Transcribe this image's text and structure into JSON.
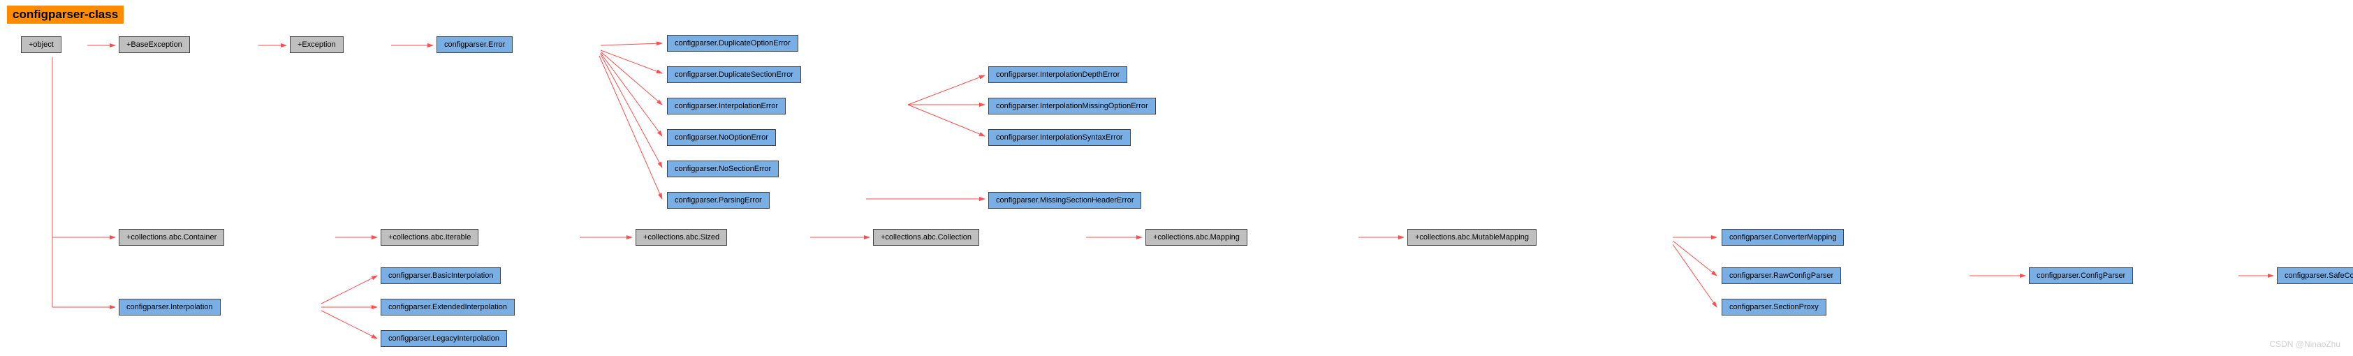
{
  "title": "configparser-class",
  "watermark": "CSDN @NinaoZhu",
  "nodes": {
    "object": "+object",
    "baseexc": "+BaseException",
    "exc": "+Exception",
    "cp_error": "configparser.Error",
    "cp_dup_opt": "configparser.DuplicateOptionError",
    "cp_dup_sec": "configparser.DuplicateSectionError",
    "cp_int_err": "configparser.InterpolationError",
    "cp_int_depth": "configparser.InterpolationDepthError",
    "cp_int_miss": "configparser.InterpolationMissingOptionError",
    "cp_int_syn": "configparser.InterpolationSyntaxError",
    "cp_noopt": "configparser.NoOptionError",
    "cp_nosec": "configparser.NoSectionError",
    "cp_parse": "configparser.ParsingError",
    "cp_misshdr": "configparser.MissingSectionHeaderError",
    "abc_container": "+collections.abc.Container",
    "abc_iterable": "+collections.abc.Iterable",
    "abc_sized": "+collections.abc.Sized",
    "abc_collection": "+collections.abc.Collection",
    "abc_mapping": "+collections.abc.Mapping",
    "abc_mutmapping": "+collections.abc.MutableMapping",
    "cp_convmap": "configparser.ConverterMapping",
    "cp_rawcfg": "configparser.RawConfigParser",
    "cp_secproxy": "configparser.SectionProxy",
    "cp_cfgparser": "configparser.ConfigParser",
    "cp_safecfg": "configparser.SafeConfigParser",
    "cp_interp": "configparser.Interpolation",
    "cp_basicint": "configparser.BasicInterpolation",
    "cp_extint": "configparser.ExtendedInterpolation",
    "cp_legint": "configparser.LegacyInterpolation"
  },
  "chart_data": {
    "type": "diagram",
    "title": "configparser-class",
    "nodes": [
      {
        "id": "object",
        "label": "+object",
        "kind": "builtin"
      },
      {
        "id": "baseexc",
        "label": "+BaseException",
        "kind": "builtin"
      },
      {
        "id": "exc",
        "label": "+Exception",
        "kind": "builtin"
      },
      {
        "id": "cp_error",
        "label": "configparser.Error",
        "kind": "module"
      },
      {
        "id": "cp_dup_opt",
        "label": "configparser.DuplicateOptionError",
        "kind": "module"
      },
      {
        "id": "cp_dup_sec",
        "label": "configparser.DuplicateSectionError",
        "kind": "module"
      },
      {
        "id": "cp_int_err",
        "label": "configparser.InterpolationError",
        "kind": "module"
      },
      {
        "id": "cp_int_depth",
        "label": "configparser.InterpolationDepthError",
        "kind": "module"
      },
      {
        "id": "cp_int_miss",
        "label": "configparser.InterpolationMissingOptionError",
        "kind": "module"
      },
      {
        "id": "cp_int_syn",
        "label": "configparser.InterpolationSyntaxError",
        "kind": "module"
      },
      {
        "id": "cp_noopt",
        "label": "configparser.NoOptionError",
        "kind": "module"
      },
      {
        "id": "cp_nosec",
        "label": "configparser.NoSectionError",
        "kind": "module"
      },
      {
        "id": "cp_parse",
        "label": "configparser.ParsingError",
        "kind": "module"
      },
      {
        "id": "cp_misshdr",
        "label": "configparser.MissingSectionHeaderError",
        "kind": "module"
      },
      {
        "id": "abc_container",
        "label": "+collections.abc.Container",
        "kind": "builtin"
      },
      {
        "id": "abc_iterable",
        "label": "+collections.abc.Iterable",
        "kind": "builtin"
      },
      {
        "id": "abc_sized",
        "label": "+collections.abc.Sized",
        "kind": "builtin"
      },
      {
        "id": "abc_collection",
        "label": "+collections.abc.Collection",
        "kind": "builtin"
      },
      {
        "id": "abc_mapping",
        "label": "+collections.abc.Mapping",
        "kind": "builtin"
      },
      {
        "id": "abc_mutmapping",
        "label": "+collections.abc.MutableMapping",
        "kind": "builtin"
      },
      {
        "id": "cp_convmap",
        "label": "configparser.ConverterMapping",
        "kind": "module"
      },
      {
        "id": "cp_rawcfg",
        "label": "configparser.RawConfigParser",
        "kind": "module"
      },
      {
        "id": "cp_secproxy",
        "label": "configparser.SectionProxy",
        "kind": "module"
      },
      {
        "id": "cp_cfgparser",
        "label": "configparser.ConfigParser",
        "kind": "module"
      },
      {
        "id": "cp_safecfg",
        "label": "configparser.SafeConfigParser",
        "kind": "module"
      },
      {
        "id": "cp_interp",
        "label": "configparser.Interpolation",
        "kind": "module"
      },
      {
        "id": "cp_basicint",
        "label": "configparser.BasicInterpolation",
        "kind": "module"
      },
      {
        "id": "cp_extint",
        "label": "configparser.ExtendedInterpolation",
        "kind": "module"
      },
      {
        "id": "cp_legint",
        "label": "configparser.LegacyInterpolation",
        "kind": "module"
      }
    ],
    "edges": [
      {
        "from": "object",
        "to": "baseexc"
      },
      {
        "from": "baseexc",
        "to": "exc"
      },
      {
        "from": "exc",
        "to": "cp_error"
      },
      {
        "from": "cp_error",
        "to": "cp_dup_opt"
      },
      {
        "from": "cp_error",
        "to": "cp_dup_sec"
      },
      {
        "from": "cp_error",
        "to": "cp_int_err"
      },
      {
        "from": "cp_error",
        "to": "cp_noopt"
      },
      {
        "from": "cp_error",
        "to": "cp_nosec"
      },
      {
        "from": "cp_error",
        "to": "cp_parse"
      },
      {
        "from": "cp_int_err",
        "to": "cp_int_depth"
      },
      {
        "from": "cp_int_err",
        "to": "cp_int_miss"
      },
      {
        "from": "cp_int_err",
        "to": "cp_int_syn"
      },
      {
        "from": "cp_parse",
        "to": "cp_misshdr"
      },
      {
        "from": "object",
        "to": "abc_container"
      },
      {
        "from": "abc_container",
        "to": "abc_iterable"
      },
      {
        "from": "abc_iterable",
        "to": "abc_sized"
      },
      {
        "from": "abc_sized",
        "to": "abc_collection"
      },
      {
        "from": "abc_collection",
        "to": "abc_mapping"
      },
      {
        "from": "abc_mapping",
        "to": "abc_mutmapping"
      },
      {
        "from": "abc_mutmapping",
        "to": "cp_convmap"
      },
      {
        "from": "abc_mutmapping",
        "to": "cp_rawcfg"
      },
      {
        "from": "abc_mutmapping",
        "to": "cp_secproxy"
      },
      {
        "from": "cp_rawcfg",
        "to": "cp_cfgparser"
      },
      {
        "from": "cp_cfgparser",
        "to": "cp_safecfg"
      },
      {
        "from": "object",
        "to": "cp_interp"
      },
      {
        "from": "cp_interp",
        "to": "cp_basicint"
      },
      {
        "from": "cp_interp",
        "to": "cp_extint"
      },
      {
        "from": "cp_interp",
        "to": "cp_legint"
      }
    ]
  }
}
